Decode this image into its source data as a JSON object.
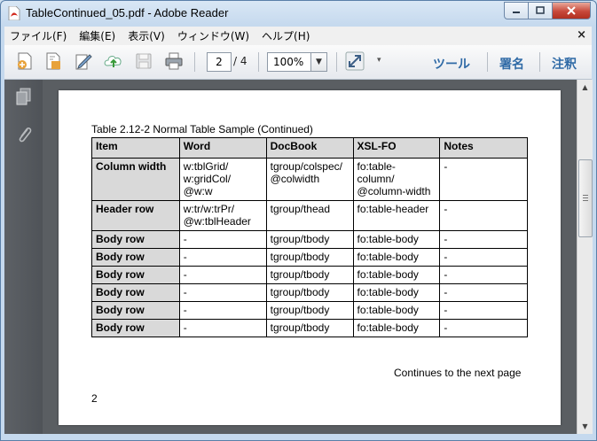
{
  "window": {
    "title": "TableContinued_05.pdf - Adobe Reader"
  },
  "menu": {
    "items": [
      "ファイル(F)",
      "編集(E)",
      "表示(V)",
      "ウィンドウ(W)",
      "ヘルプ(H)"
    ]
  },
  "toolbar": {
    "page_current": "2",
    "page_total": "/ 4",
    "zoom": "100%",
    "tools_label": "ツール",
    "sign_label": "署名",
    "comment_label": "注釈",
    "icons": [
      "create-pdf-icon",
      "edit-pdf-icon",
      "sign-icon",
      "upload-icon",
      "save-icon",
      "print-icon",
      "expand-icon"
    ]
  },
  "document": {
    "caption": "Table 2.12-2 Normal Table Sample (Continued)",
    "headers": [
      "Item",
      "Word",
      "DocBook",
      "XSL-FO",
      "Notes"
    ],
    "rows": [
      [
        "Column width",
        "w:tblGrid/\nw:gridCol/\n@w:w",
        "tgroup/colspec/\n@colwidth",
        "fo:table-\ncolumn/\n@column-width",
        "-"
      ],
      [
        "Header row",
        "w:tr/w:trPr/\n@w:tblHeader",
        "tgroup/thead",
        "fo:table-header",
        "-"
      ],
      [
        "Body row",
        "-",
        "tgroup/tbody",
        "fo:table-body",
        "-"
      ],
      [
        "Body row",
        "-",
        "tgroup/tbody",
        "fo:table-body",
        "-"
      ],
      [
        "Body row",
        "-",
        "tgroup/tbody",
        "fo:table-body",
        "-"
      ],
      [
        "Body row",
        "-",
        "tgroup/tbody",
        "fo:table-body",
        "-"
      ],
      [
        "Body row",
        "-",
        "tgroup/tbody",
        "fo:table-body",
        "-"
      ],
      [
        "Body row",
        "-",
        "tgroup/tbody",
        "fo:table-body",
        "-"
      ]
    ],
    "continues": "Continues to the next page",
    "page_number": "2"
  },
  "colors": {
    "accent_text": "#2f6aa6",
    "header_fill": "#d9d9d9",
    "doc_background": "#5a5e62"
  }
}
